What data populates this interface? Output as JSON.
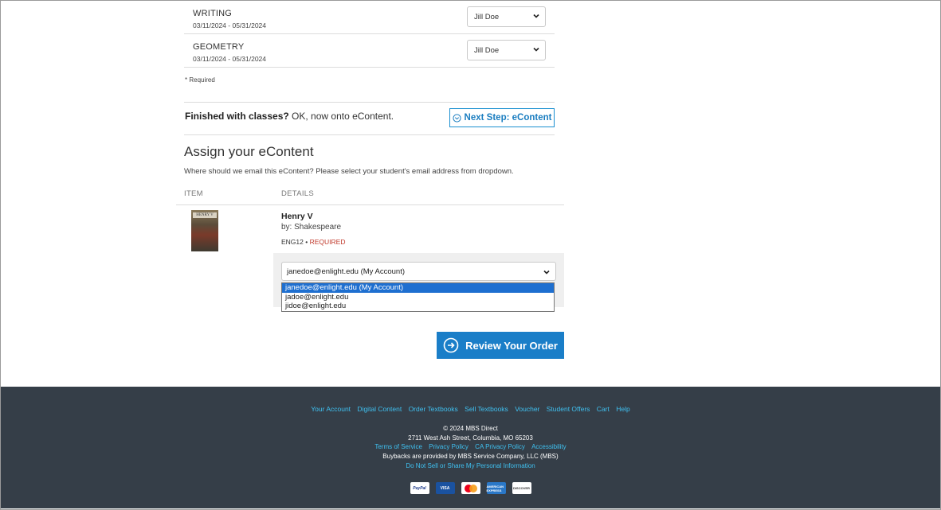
{
  "classes": [
    {
      "name": "WRITING",
      "dates": "03/11/2024 - 05/31/2024",
      "teacher": "Jill Doe"
    },
    {
      "name": "GEOMETRY",
      "dates": "03/11/2024 - 05/31/2024",
      "teacher": "Jill Doe"
    }
  ],
  "required_note": "* Required",
  "finished": {
    "bold": "Finished with classes?",
    "text": " OK, now onto eContent.",
    "button": "Next Step: eContent"
  },
  "assign": {
    "title": "Assign your eContent",
    "subtitle": "Where should we email this eContent? Please select your student's email address from dropdown.",
    "col_item": "ITEM",
    "col_details": "DETAILS"
  },
  "book": {
    "title": "Henry V",
    "author": "by: Shakespeare",
    "course": "ENG12",
    "sep": "•",
    "required": "REQUIRED",
    "cover_text": "HENRY V"
  },
  "email": {
    "selected": "janedoe@enlight.edu (My Account)",
    "options": [
      "janedoe@enlight.edu (My Account)",
      "jadoe@enlight.edu",
      "jidoe@enlight.edu"
    ]
  },
  "review_button": "Review Your Order",
  "footer": {
    "links": [
      "Your Account",
      "Digital Content",
      "Order Textbooks",
      "Sell Textbooks",
      "Voucher",
      "Student Offers",
      "Cart",
      "Help"
    ],
    "copyright": "© 2024 MBS Direct",
    "address": "2711 West Ash Street, Columbia, MO 65203",
    "legal_links": [
      "Terms of Service",
      "Privacy Policy",
      "CA Privacy Policy",
      "Accessibility"
    ],
    "buybacks": "Buybacks are provided by MBS Service Company, LLC (MBS)",
    "do_not_sell": "Do Not Sell or Share My Personal Information",
    "payments": {
      "paypal": "PayPal",
      "visa": "VISA",
      "amex": "AMERICAN EXPRESS",
      "discover": "DISCOVER"
    }
  },
  "colors": {
    "accent": "#1a7ec8",
    "footer_bg": "#353e48",
    "link": "#3fc0f0",
    "required": "#c0392b"
  }
}
